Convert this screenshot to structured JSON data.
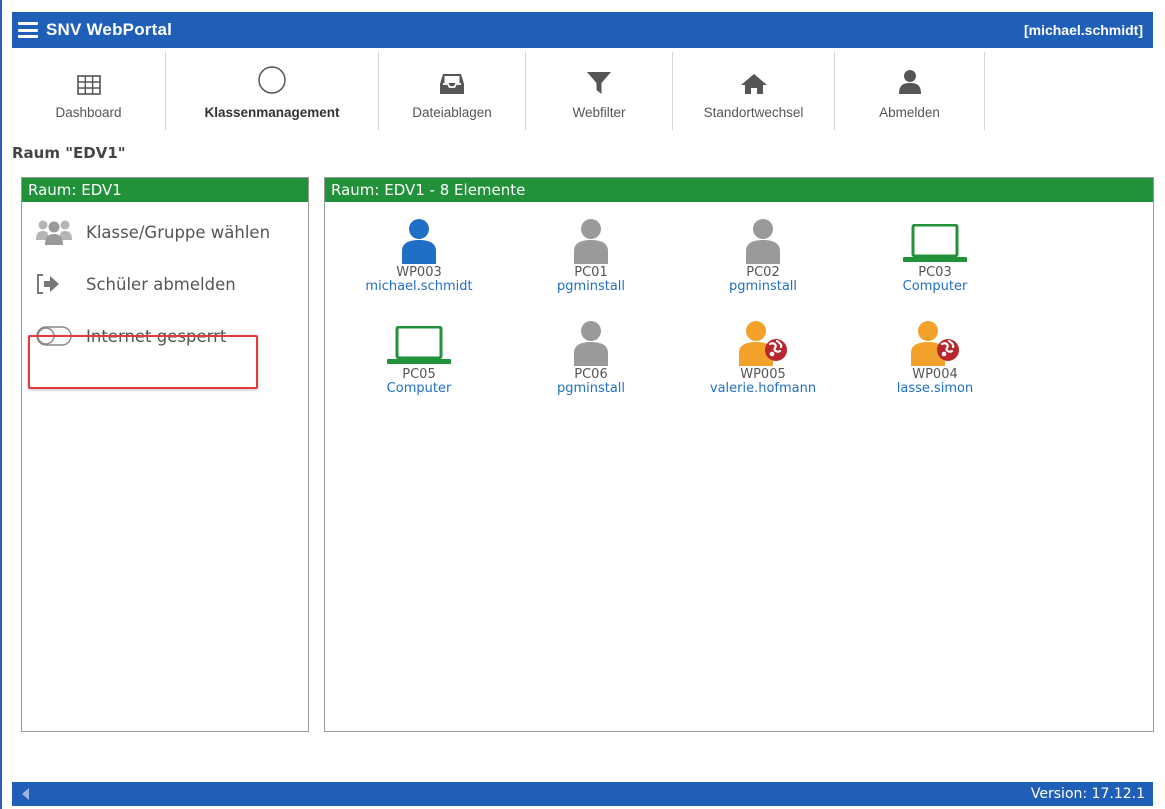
{
  "header": {
    "title": "SNV WebPortal",
    "user": "[michael.schmidt]"
  },
  "nav": {
    "items": [
      {
        "id": "dashboard",
        "label": "Dashboard",
        "icon": "grid-icon",
        "active": false
      },
      {
        "id": "klassenmanagement",
        "label": "Klassenmanagement",
        "icon": "circle-icon",
        "active": true
      },
      {
        "id": "dateiablagen",
        "label": "Dateiablagen",
        "icon": "inbox-icon",
        "active": false
      },
      {
        "id": "webfilter",
        "label": "Webfilter",
        "icon": "filter-icon",
        "active": false
      },
      {
        "id": "standortwechsel",
        "label": "Standortwechsel",
        "icon": "home-icon",
        "active": false
      },
      {
        "id": "abmelden",
        "label": "Abmelden",
        "icon": "user-icon",
        "active": false
      }
    ]
  },
  "page": {
    "title": "Raum \"EDV1\""
  },
  "left_panel": {
    "header": "Raum: EDV1",
    "actions": [
      {
        "label": "Klasse/Gruppe wählen",
        "icon": "group-icon"
      },
      {
        "label": "Schüler abmelden",
        "icon": "logout-icon"
      },
      {
        "label": "Internet gesperrt",
        "icon": "toggle-icon"
      }
    ]
  },
  "right_panel": {
    "header": "Raum: EDV1 - 8 Elemente",
    "devices": [
      {
        "name": "WP003",
        "user": "michael.schmidt",
        "icon": "user-blue-icon"
      },
      {
        "name": "PC01",
        "user": "pgminstall",
        "icon": "user-gray-icon"
      },
      {
        "name": "PC02",
        "user": "pgminstall",
        "icon": "user-gray-icon"
      },
      {
        "name": "PC03",
        "user": "Computer",
        "icon": "laptop-icon"
      },
      {
        "name": "PC05",
        "user": "Computer",
        "icon": "laptop-icon"
      },
      {
        "name": "PC06",
        "user": "pgminstall",
        "icon": "user-gray-icon"
      },
      {
        "name": "WP005",
        "user": "valerie.hofmann",
        "icon": "user-orange-blocked-icon"
      },
      {
        "name": "WP004",
        "user": "lasse.simon",
        "icon": "user-orange-blocked-icon"
      }
    ]
  },
  "footer": {
    "version": "Version: 17.12.1"
  },
  "colors": {
    "brand": "#1f5fb8",
    "panel_header": "#21913a",
    "link": "#1f6fc6",
    "highlight": "#e0393e"
  }
}
